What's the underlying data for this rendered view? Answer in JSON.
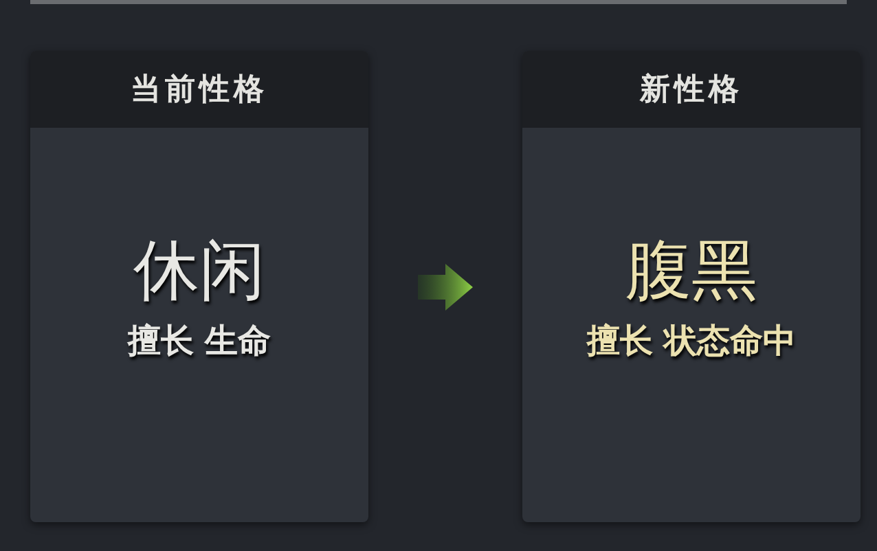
{
  "cards": [
    {
      "kind": "current",
      "header": "当前性格",
      "name": "休闲",
      "specialty": "擅长 生命"
    },
    {
      "kind": "new",
      "header": "新性格",
      "name": "腹黑",
      "specialty": "擅长 状态命中"
    }
  ]
}
